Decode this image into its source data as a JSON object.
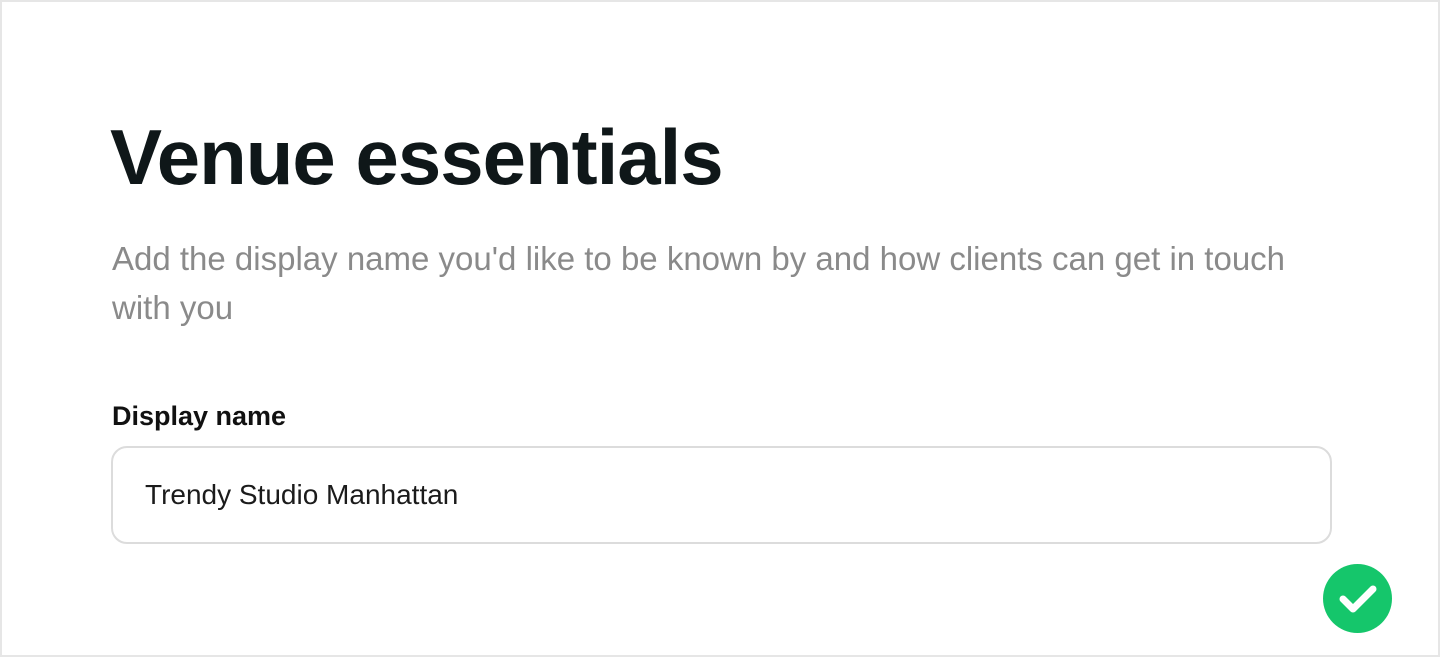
{
  "header": {
    "title": "Venue essentials",
    "subtitle": "Add the display name you'd like to be known by and how clients can get in touch with you"
  },
  "form": {
    "display_name": {
      "label": "Display name",
      "value": "Trendy Studio Manhattan"
    }
  },
  "status": {
    "icon": "check-circle-icon",
    "color": "#15c66b"
  }
}
